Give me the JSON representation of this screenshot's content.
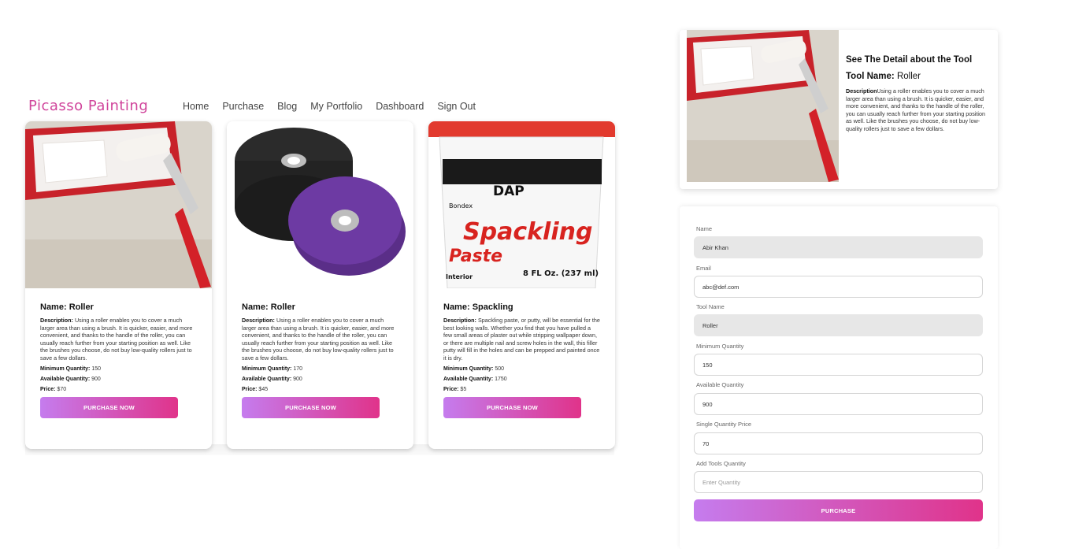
{
  "brand": "Picasso Painting",
  "nav": [
    "Home",
    "Purchase",
    "Blog",
    "My Portfolio",
    "Dashboard",
    "Sign Out"
  ],
  "cards": [
    {
      "name_label": "Name:",
      "name": "Roller",
      "desc_label": "Description:",
      "description": "Using a roller enables you to cover a much larger area than using a brush. It is quicker, easier, and more convenient, and thanks to the handle of the roller, you can usually reach further from your starting position as well. Like the brushes you choose, do not buy low-quality rollers just to save a few dollars.",
      "min_label": "Minimum Quantity:",
      "min_qty": "150",
      "avail_label": "Available Quantity:",
      "avail_qty": "900",
      "price_label": "Price:",
      "price": "$70",
      "button": "PURCHASE NOW",
      "image": "paint-roller-tray"
    },
    {
      "name_label": "Name:",
      "name": "Roller",
      "desc_label": "Description:",
      "description": "Using a roller enables you to cover a much larger area than using a brush. It is quicker, easier, and more convenient, and thanks to the handle of the roller, you can usually reach further from your starting position as well. Like the brushes you choose, do not buy low-quality rollers just to save a few dollars.",
      "min_label": "Minimum Quantity:",
      "min_qty": "170",
      "avail_label": "Available Quantity:",
      "avail_qty": "900",
      "price_label": "Price:",
      "price": "$45",
      "button": "PURCHASE NOW",
      "image": "abrasive-discs"
    },
    {
      "name_label": "Name:",
      "name": "Spackling",
      "desc_label": "Description:",
      "description": "Spackling paste, or putty, will be essential for the best looking walls. Whether you find that you have pulled a few small areas of plaster out while stripping wallpaper down, or there are multiple nail and screw holes in the wall, this filler putty will fill in the holes and can be prepped and painted once it is dry.",
      "min_label": "Minimum Quantity:",
      "min_qty": "500",
      "avail_label": "Available Quantity:",
      "avail_qty": "1750",
      "price_label": "Price:",
      "price": "$5",
      "button": "PURCHASE NOW",
      "image": "spackling-tub"
    }
  ],
  "detail": {
    "heading": "See The Detail about the Tool",
    "tool_name_label": "Tool Name:",
    "tool_name": "Roller",
    "desc_label": "Description",
    "description": "Using a roller enables you to cover a much larger area than using a brush. It is quicker, easier, and more convenient, and thanks to the handle of the roller, you can usually reach further from your starting position as well. Like the brushes you choose, do not buy low-quality rollers just to save a few dollars.",
    "image": "paint-roller-tray"
  },
  "form": {
    "name_label": "Name",
    "name_value": "Abir Khan",
    "email_label": "Email",
    "email_value": "abc@def.com",
    "tool_label": "Tool Name",
    "tool_value": "Roller",
    "min_label": "Minimum Quantity",
    "min_value": "150",
    "avail_label": "Available Quantity",
    "avail_value": "900",
    "price_label": "Single Quantity Price",
    "price_value": "70",
    "add_label": "Add Tools Quantity",
    "add_placeholder": "Enter Quantity",
    "button": "PURCHASE"
  },
  "product_art": {
    "tub_brand": "DAP",
    "tub_sub": "Bondex",
    "tub_title_1": "Spackling",
    "tub_title_2": "Paste",
    "tub_type": "Interior",
    "tub_size": "8 FL Oz. (237 ml)"
  },
  "colors": {
    "accent_start": "#c57cee",
    "accent_end": "#e0338a",
    "brand": "#d0449b"
  }
}
